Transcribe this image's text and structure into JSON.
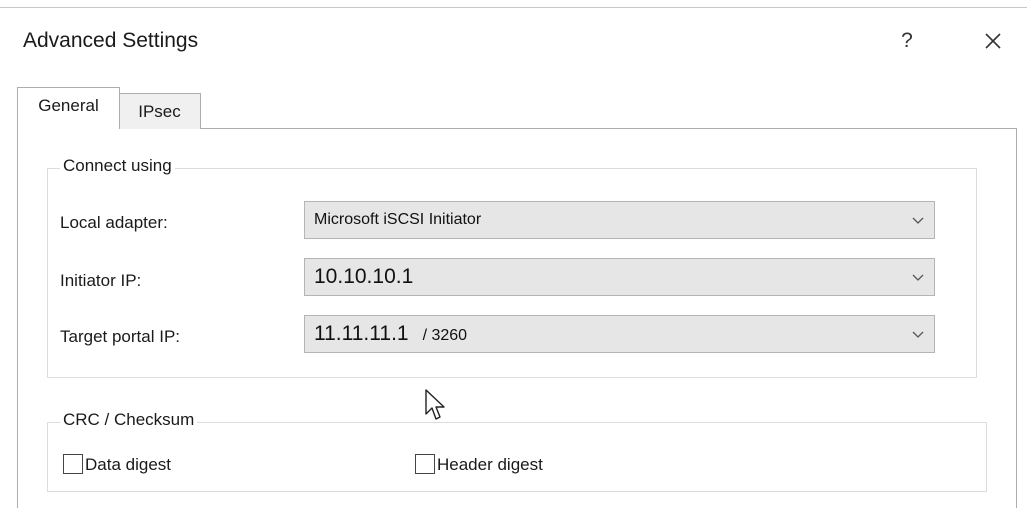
{
  "window": {
    "title": "Advanced Settings",
    "help_label": "?"
  },
  "tabs": [
    {
      "label": "General",
      "active": true
    },
    {
      "label": "IPsec",
      "active": false
    }
  ],
  "connect_using": {
    "legend": "Connect using",
    "local_adapter": {
      "label": "Local adapter:",
      "value": "Microsoft iSCSI Initiator"
    },
    "initiator_ip": {
      "label": "Initiator IP:",
      "value": "10.10.10.1"
    },
    "target_portal_ip": {
      "label": "Target portal IP:",
      "value": "11.11.11.1",
      "port": "/ 3260"
    }
  },
  "crc_checksum": {
    "legend": "CRC / Checksum",
    "data_digest": {
      "label": "Data digest",
      "checked": false
    },
    "header_digest": {
      "label": "Header digest",
      "checked": false
    }
  },
  "icons": [
    "close-icon",
    "chevron-down-icon",
    "mouse-pointer-icon"
  ],
  "colors": {
    "combo_background": "#e6e6e6",
    "inactive_tab": "#f0f0f0",
    "border": "#adadad"
  }
}
